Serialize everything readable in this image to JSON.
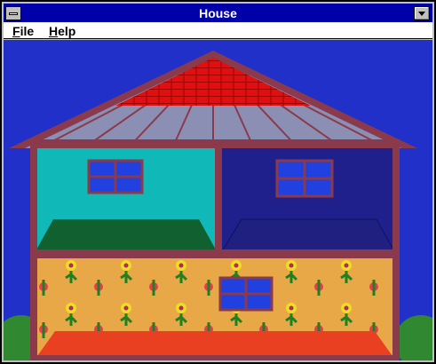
{
  "window": {
    "title": "House"
  },
  "menu": {
    "items": [
      "File",
      "Help"
    ]
  },
  "colors": {
    "sky": "#2030c8",
    "roof_top": "#e01010",
    "roof": "#8c8fb4",
    "roof_trim": "#8a3a4a",
    "room_left": "#10b8b8",
    "room_left_floor": "#106030",
    "room_right": "#20208c",
    "room_right_floor": "#202080",
    "ground_floor_wall": "#e8a848",
    "ground_floor_rug": "#e84020",
    "window_glass": "#2040e0",
    "shrub": "#308830",
    "flower": "#e8e020"
  },
  "icons": [
    "system-menu-icon",
    "minimize-arrow-icon"
  ]
}
